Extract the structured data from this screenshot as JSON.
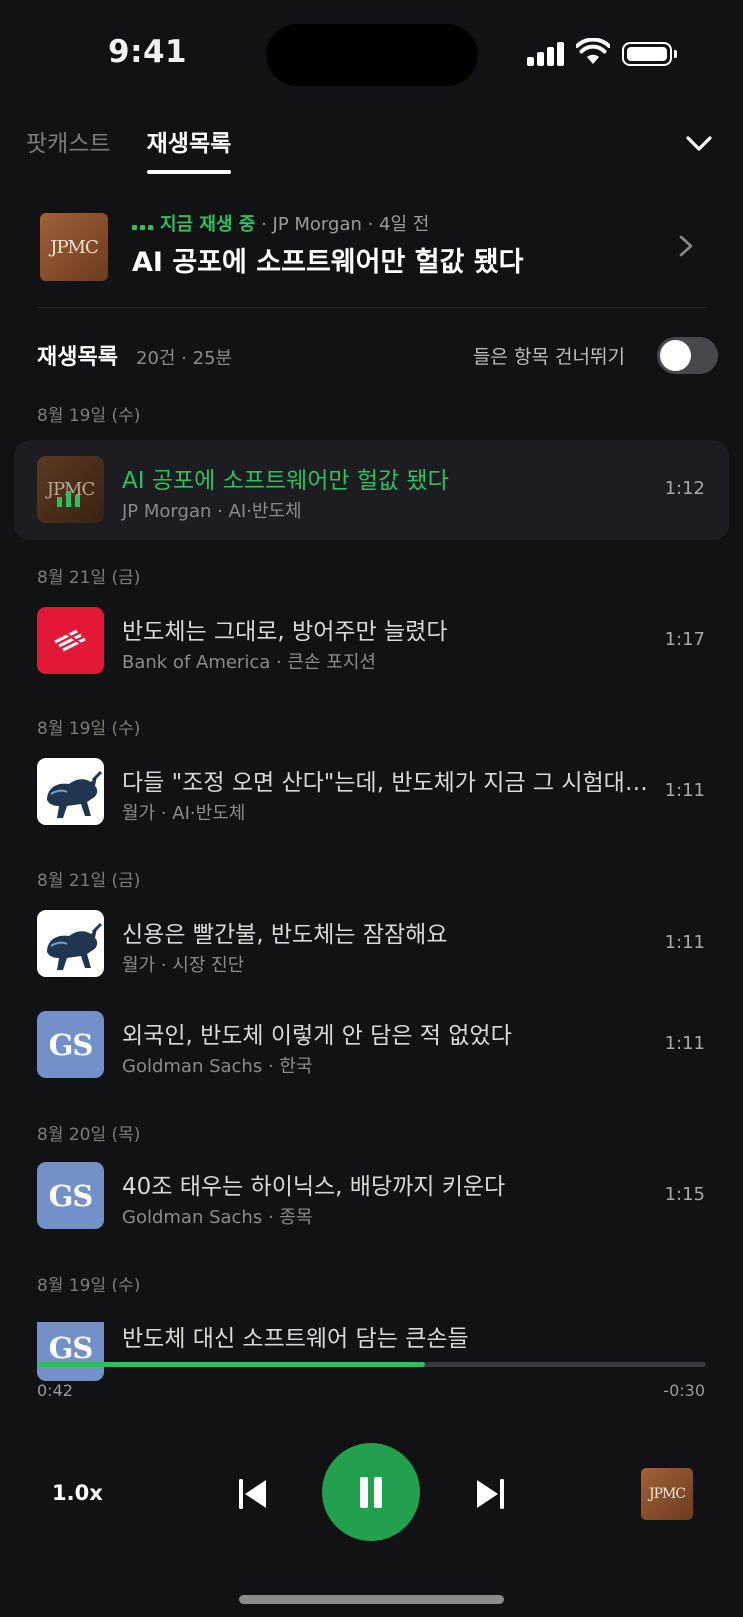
{
  "status_bar": {
    "time": "9:41"
  },
  "tabs": [
    {
      "label": "팟캐스트",
      "active": false
    },
    {
      "label": "재생목록",
      "active": true
    }
  ],
  "now_playing": {
    "status_label": "지금 재생 중",
    "meta": " · JP Morgan · 4일 전",
    "title": "AI 공포에 소프트웨어만 헐값 됐다",
    "art": "JPMC"
  },
  "playlist_header": {
    "title": "재생목록",
    "meta": "20건 · 25분",
    "skip_label": "들은 항목 건너뛰기",
    "skip_enabled": false
  },
  "sections": [
    {
      "date": "8월 19일 (수)"
    },
    {
      "date": "8월 21일 (금)"
    },
    {
      "date": "8월 19일 (수)"
    },
    {
      "date": "8월 21일 (금)"
    },
    {
      "date": "8월 20일 (목)"
    },
    {
      "date": "8월 19일 (수)"
    }
  ],
  "episodes": [
    {
      "title": "AI 공포에 소프트웨어만 헐값 됐다",
      "subtitle": "JP Morgan · AI·반도체",
      "duration": "1:12",
      "art": "JPMC",
      "current": true
    },
    {
      "title": "반도체는 그대로, 방어주만 늘렸다",
      "subtitle": "Bank of America · 큰손 포지션",
      "duration": "1:17",
      "art": "boa-logo"
    },
    {
      "title": "다들 \"조정 오면 산다\"는데, 반도체가 지금 그 시험대…",
      "subtitle": "월가 · AI·반도체",
      "duration": "1:11",
      "art": "bull-icon"
    },
    {
      "title": "신용은 빨간불, 반도체는 잠잠해요",
      "subtitle": "월가 · 시장 진단",
      "duration": "1:11",
      "art": "bull-icon"
    },
    {
      "title": "외국인, 반도체 이렇게 안 담은 적 없었다",
      "subtitle": "Goldman Sachs · 한국",
      "duration": "1:11",
      "art": "GS"
    },
    {
      "title": "40조 태우는 하이닉스, 배당까지 키운다",
      "subtitle": "Goldman Sachs · 종목",
      "duration": "1:15",
      "art": "GS"
    },
    {
      "title": "반도체 대신 소프트웨어 담는 큰손들",
      "subtitle": "",
      "duration": "",
      "art": "GS"
    }
  ],
  "player": {
    "elapsed": "0:42",
    "remaining": "-0:30",
    "progress": 0.58,
    "speed": "1.0x",
    "art": "JPMC"
  },
  "colors": {
    "accent": "#2fbf5f",
    "background": "#121214",
    "play_button": "#23a04e"
  }
}
